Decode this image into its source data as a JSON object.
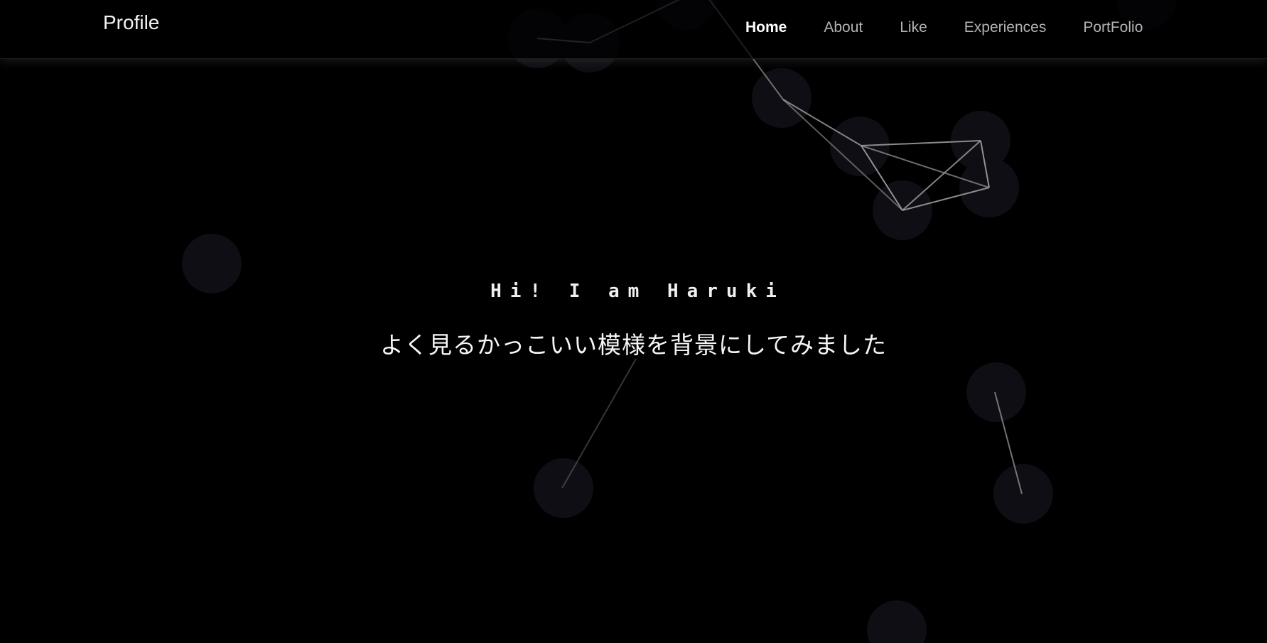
{
  "nav": {
    "brand": "Profile",
    "links": [
      {
        "label": "Home",
        "active": true
      },
      {
        "label": "About",
        "active": false
      },
      {
        "label": "Like",
        "active": false
      },
      {
        "label": "Experiences",
        "active": false
      },
      {
        "label": "PortFolio",
        "active": false
      }
    ]
  },
  "hero": {
    "greeting": "Hi! I am Haruki",
    "subtitle": "よく見るかっこいい模様を背景にしてみました"
  },
  "colors": {
    "background": "#000000",
    "particle": "#0e0e14",
    "line": "#9a9a9a",
    "nav_active": "#ffffff",
    "nav_inactive": "#b3b3b3"
  }
}
